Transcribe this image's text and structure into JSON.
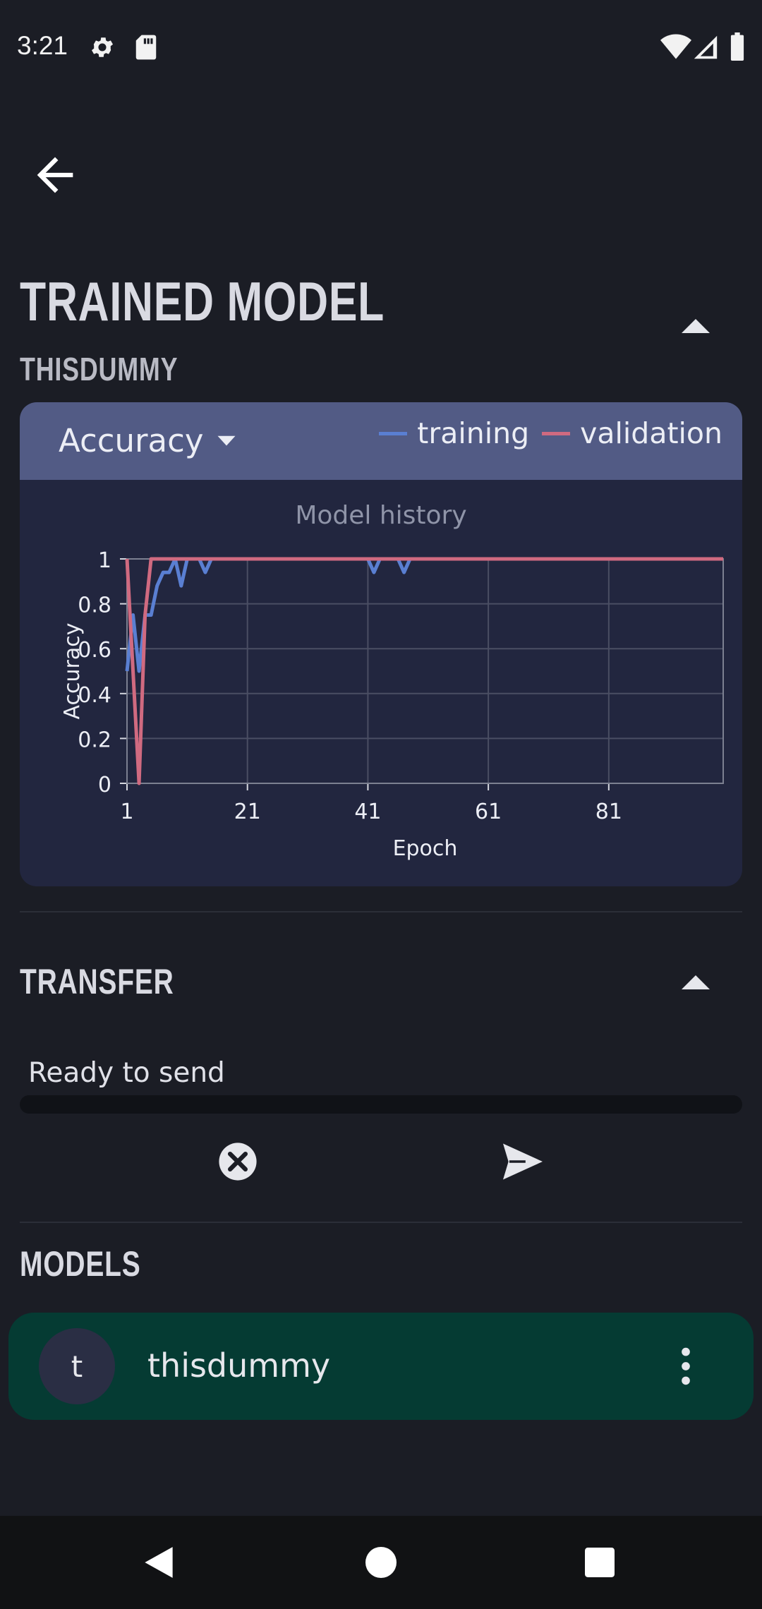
{
  "status_bar": {
    "time": "3:21"
  },
  "header": {
    "title": "TRAINED MODEL",
    "subtitle": "THISDUMMY"
  },
  "chart_card": {
    "selected_metric": "Accuracy",
    "legend": {
      "training": "training",
      "validation": "validation"
    },
    "colors": {
      "training": "#5a7fd2",
      "validation": "#d06a80"
    }
  },
  "chart_data": {
    "type": "line",
    "title": "Model history",
    "xlabel": "Epoch",
    "ylabel": "Accuracy",
    "xlim": [
      1,
      100
    ],
    "ylim": [
      0,
      1
    ],
    "x_ticks": [
      "1",
      "21",
      "41",
      "61",
      "81"
    ],
    "y_ticks": [
      "0",
      "0.2",
      "0.4",
      "0.6",
      "0.8",
      "1"
    ],
    "grid": true,
    "series": [
      {
        "name": "training",
        "x": [
          1,
          2,
          3,
          4,
          5,
          6,
          7,
          8,
          9,
          10,
          11,
          12,
          13,
          14,
          15,
          16,
          17,
          18,
          19,
          20,
          40,
          41,
          42,
          43,
          44,
          45,
          46,
          47,
          48,
          100
        ],
        "values": [
          0.5,
          0.75,
          0.5,
          0.75,
          0.75,
          0.88,
          0.94,
          0.94,
          1.0,
          0.88,
          1.0,
          1.0,
          1.0,
          0.94,
          1.0,
          1.0,
          1.0,
          1.0,
          1.0,
          1.0,
          1.0,
          1.0,
          0.94,
          1.0,
          1.0,
          1.0,
          1.0,
          0.94,
          1.0,
          1.0
        ]
      },
      {
        "name": "validation",
        "x": [
          1,
          2,
          3,
          4,
          5,
          100
        ],
        "values": [
          1.0,
          0.5,
          0.0,
          0.75,
          1.0,
          1.0
        ]
      }
    ]
  },
  "transfer": {
    "title": "TRANSFER",
    "status": "Ready to send",
    "progress": 0
  },
  "models": {
    "title": "MODELS",
    "items": [
      {
        "initial": "t",
        "name": "thisdummy"
      }
    ]
  }
}
